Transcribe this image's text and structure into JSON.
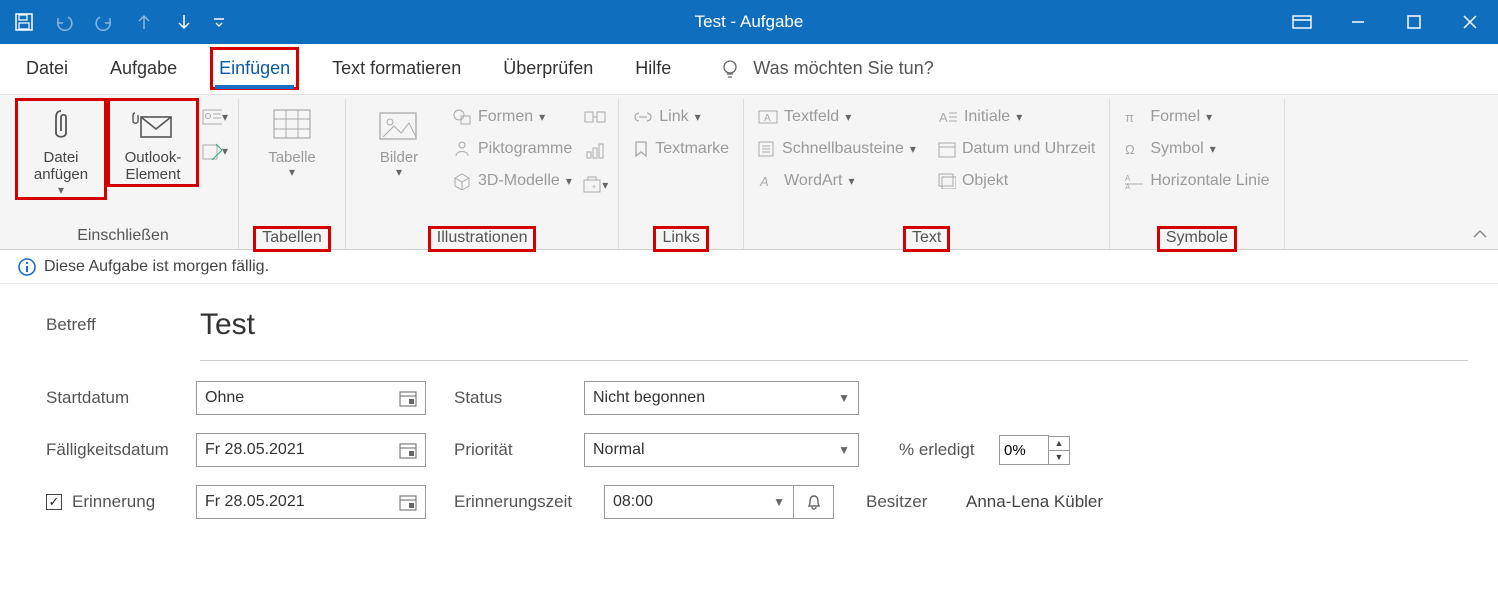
{
  "window": {
    "title": "Test  -  Aufgabe"
  },
  "tabs": {
    "datei": "Datei",
    "aufgabe": "Aufgabe",
    "einfuegen": "Einfügen",
    "textformat": "Text formatieren",
    "ueberpruefen": "Überprüfen",
    "hilfe": "Hilfe",
    "tellme": "Was möchten Sie tun?"
  },
  "ribbon": {
    "include": {
      "name": "Einschließen",
      "attach_file": "Datei anfügen",
      "outlook_item": "Outlook-Element"
    },
    "tables": {
      "name": "Tabellen",
      "table": "Tabelle"
    },
    "illus": {
      "name": "Illustrationen",
      "pictures": "Bilder",
      "shapes": "Formen",
      "pictograms": "Piktogramme",
      "models3d": "3D-Modelle"
    },
    "links": {
      "name": "Links",
      "link": "Link",
      "bookmark": "Textmarke"
    },
    "text": {
      "name": "Text",
      "textbox": "Textfeld",
      "quickparts": "Schnellbausteine",
      "wordart": "WordArt",
      "initial": "Initiale",
      "datetime": "Datum und Uhrzeit",
      "object": "Objekt"
    },
    "symbols": {
      "name": "Symbole",
      "formula": "Formel",
      "symbol": "Symbol",
      "hline": "Horizontale Linie"
    }
  },
  "infobar": {
    "text": "Diese Aufgabe ist morgen fällig."
  },
  "form": {
    "subject_label": "Betreff",
    "subject_value": "Test",
    "startdate_label": "Startdatum",
    "startdate_value": "Ohne",
    "duedate_label": "Fälligkeitsdatum",
    "duedate_value": "Fr 28.05.2021",
    "status_label": "Status",
    "status_value": "Nicht begonnen",
    "priority_label": "Priorität",
    "priority_value": "Normal",
    "percent_label": "% erledigt",
    "percent_value": "0%",
    "reminder_label": "Erinnerung",
    "reminder_checked": true,
    "reminder_date": "Fr 28.05.2021",
    "remindertime_label": "Erinnerungszeit",
    "remindertime_value": "08:00",
    "owner_label": "Besitzer",
    "owner_value": "Anna-Lena Kübler"
  }
}
